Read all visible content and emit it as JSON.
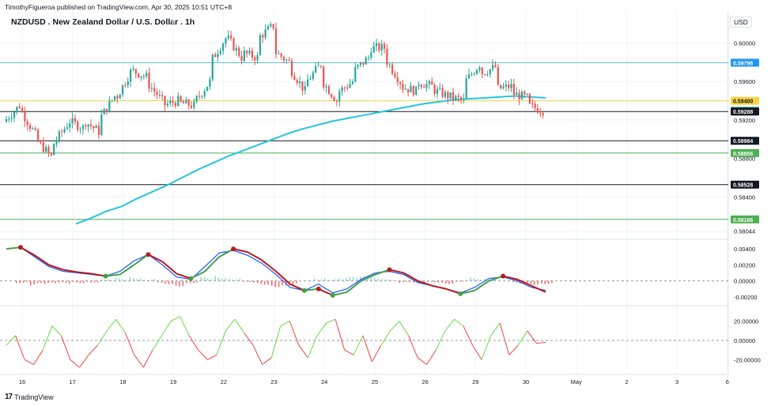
{
  "header": {
    "published_line": "TimothyFigueroa published on TradingView.com, Apr 30, 2025 10:51 UTC+8",
    "symbol_title": "NZDUSD . New Zealand Dollar / U.S. Dollar . 1h",
    "currency": "USD",
    "footer_brand": "TradingView"
  },
  "colors": {
    "up": "#26a69a",
    "down": "#ef5350",
    "ema": "#26c6da",
    "level_teal": "#5fb9c9",
    "level_yellow": "#f5d442",
    "level_black": "#131722",
    "level_green": "#4caf50",
    "macd_line": "#2962ff",
    "signal_down": "#b71c1c",
    "signal_up": "#43a047",
    "osc_up": "#66dd44",
    "osc_down": "#ee4444"
  },
  "chart_data": [
    {
      "type": "candlestick",
      "title": "NZDUSD . New Zealand Dollar / U.S. Dollar . 1h",
      "x_labels": [
        "16",
        "17",
        "18",
        "19",
        "22",
        "23",
        "24",
        "25",
        "26",
        "29",
        "30",
        "May",
        "2",
        "3",
        "6"
      ],
      "y_ticks": [
        "0.60000",
        "0.59600",
        "0.59200",
        "0.58800",
        "0.58400",
        "0.58044"
      ],
      "ylim": [
        0.58,
        0.603
      ],
      "price_labels": [
        {
          "value": 0.59796,
          "label": "0.59796",
          "style": "teal"
        },
        {
          "value": 0.594,
          "label": "0.59400",
          "style": "yellow"
        },
        {
          "value": 0.59296,
          "label": "0.59296",
          "style": "teal-fill"
        },
        {
          "value": 0.59288,
          "label": "0.59288",
          "style": "black"
        },
        {
          "value": 0.58984,
          "label": "0.58984",
          "style": "black"
        },
        {
          "value": 0.58856,
          "label": "0.58856",
          "style": "green"
        },
        {
          "value": 0.58528,
          "label": "0.58528",
          "style": "black"
        },
        {
          "value": 0.58166,
          "label": "0.58166",
          "style": "green"
        }
      ],
      "price_path": [
        [
          0.5918,
          0.5935
        ],
        [
          0.5932,
          0.5905
        ],
        [
          0.59,
          0.5882
        ],
        [
          0.5892,
          0.5915
        ],
        [
          0.592,
          0.5912
        ],
        [
          0.592,
          0.5908
        ],
        [
          0.592,
          0.5945
        ],
        [
          0.594,
          0.597
        ],
        [
          0.5972,
          0.5965
        ],
        [
          0.596,
          0.594
        ],
        [
          0.5935,
          0.594
        ],
        [
          0.5938,
          0.5935
        ],
        [
          0.5938,
          0.596
        ],
        [
          0.598,
          0.6005
        ],
        [
          0.6008,
          0.5985
        ],
        [
          0.599,
          0.5985
        ],
        [
          0.6005,
          0.6018
        ],
        [
          0.5992,
          0.598
        ],
        [
          0.5975,
          0.595
        ],
        [
          0.5958,
          0.5978
        ],
        [
          0.5962,
          0.594
        ],
        [
          0.5948,
          0.596
        ],
        [
          0.597,
          0.5985
        ],
        [
          0.5995,
          0.5995
        ],
        [
          0.5985,
          0.596
        ],
        [
          0.5955,
          0.595
        ],
        [
          0.596,
          0.5955
        ],
        [
          0.5952,
          0.5945
        ],
        [
          0.5945,
          0.594
        ],
        [
          0.5958,
          0.5978
        ],
        [
          0.5968,
          0.5975
        ],
        [
          0.5952,
          0.5955
        ],
        [
          0.5948,
          0.5943
        ],
        [
          0.5935,
          0.593
        ]
      ],
      "ema_path": [
        0.5812,
        0.5818,
        0.5825,
        0.583,
        0.5838,
        0.5845,
        0.5852,
        0.586,
        0.5868,
        0.5875,
        0.5882,
        0.5888,
        0.5894,
        0.59,
        0.5906,
        0.5911,
        0.5915,
        0.5919,
        0.5922,
        0.5925,
        0.5928,
        0.5931,
        0.5934,
        0.5937,
        0.5939,
        0.5941,
        0.5942,
        0.5943,
        0.5944,
        0.5945,
        0.5944,
        0.5943
      ]
    },
    {
      "type": "line",
      "name": "MACD panel",
      "y_ticks": [
        "0.00400",
        "0.00200",
        "0.00000",
        "-0.00200"
      ],
      "ylim": [
        -0.0026,
        0.0047
      ],
      "macd": [
        0.004,
        0.0042,
        0.003,
        0.0018,
        0.0012,
        0.001,
        0.0008,
        0.0006,
        0.0012,
        0.0025,
        0.0033,
        0.002,
        0.0005,
        0.0002,
        0.0018,
        0.0035,
        0.0038,
        0.0032,
        0.0022,
        0.0008,
        -0.0008,
        -0.0012,
        -0.0004,
        -0.0015,
        -0.001,
        0.0002,
        0.001,
        0.0012,
        0.0008,
        -0.0002,
        -0.0006,
        -0.001,
        -0.0015,
        -0.0008,
        0.0003,
        0.0005,
        0.0,
        -0.0008,
        -0.0012
      ],
      "signal": [
        0.004,
        0.0042,
        0.0032,
        0.002,
        0.0014,
        0.0011,
        0.0009,
        0.0006,
        0.0008,
        0.002,
        0.0033,
        0.0024,
        0.0009,
        0.0003,
        0.0012,
        0.003,
        0.004,
        0.0036,
        0.0026,
        0.0012,
        -0.0004,
        -0.0012,
        -0.001,
        -0.0018,
        -0.0014,
        0.0,
        0.0008,
        0.0014,
        0.001,
        0.0,
        -0.0006,
        -0.001,
        -0.0016,
        -0.0012,
        0.0,
        0.0006,
        0.0002,
        -0.0006,
        -0.0014
      ],
      "histogram": [
        0.0,
        -0.0003,
        -0.0006,
        -0.0005,
        -0.0004,
        -0.0003,
        -0.0002,
        0.0002,
        0.0004,
        0.0006,
        0.0003,
        -0.0004,
        -0.0007,
        -0.0003,
        0.0005,
        0.0007,
        0.0004,
        -0.0002,
        -0.0005,
        -0.0008,
        -0.0006,
        0.0,
        0.0004,
        0.0003,
        0.0005,
        0.0006,
        0.0004,
        0.0002,
        -0.0003,
        -0.0004,
        -0.0002,
        -0.0004,
        -0.0001,
        0.0004,
        0.0003,
        0.0,
        -0.0004,
        -0.0005,
        -0.0004
      ]
    },
    {
      "type": "line",
      "name": "Oscillator panel",
      "y_ticks": [
        "20.00000",
        "0.00000",
        "-20.00000"
      ],
      "ylim": [
        -32,
        32
      ],
      "values": [
        -5,
        5,
        -20,
        -25,
        -10,
        15,
        5,
        -20,
        -28,
        -15,
        -5,
        10,
        22,
        8,
        -15,
        -28,
        -10,
        5,
        20,
        25,
        5,
        -10,
        -20,
        -15,
        10,
        22,
        8,
        -5,
        -25,
        -18,
        15,
        20,
        -5,
        -18,
        5,
        18,
        22,
        -10,
        -15,
        5,
        -22,
        -5,
        10,
        20,
        5,
        -18,
        -25,
        -10,
        10,
        22,
        15,
        -5,
        -20,
        5,
        18,
        -15,
        -5,
        10,
        -3,
        -2
      ]
    }
  ]
}
